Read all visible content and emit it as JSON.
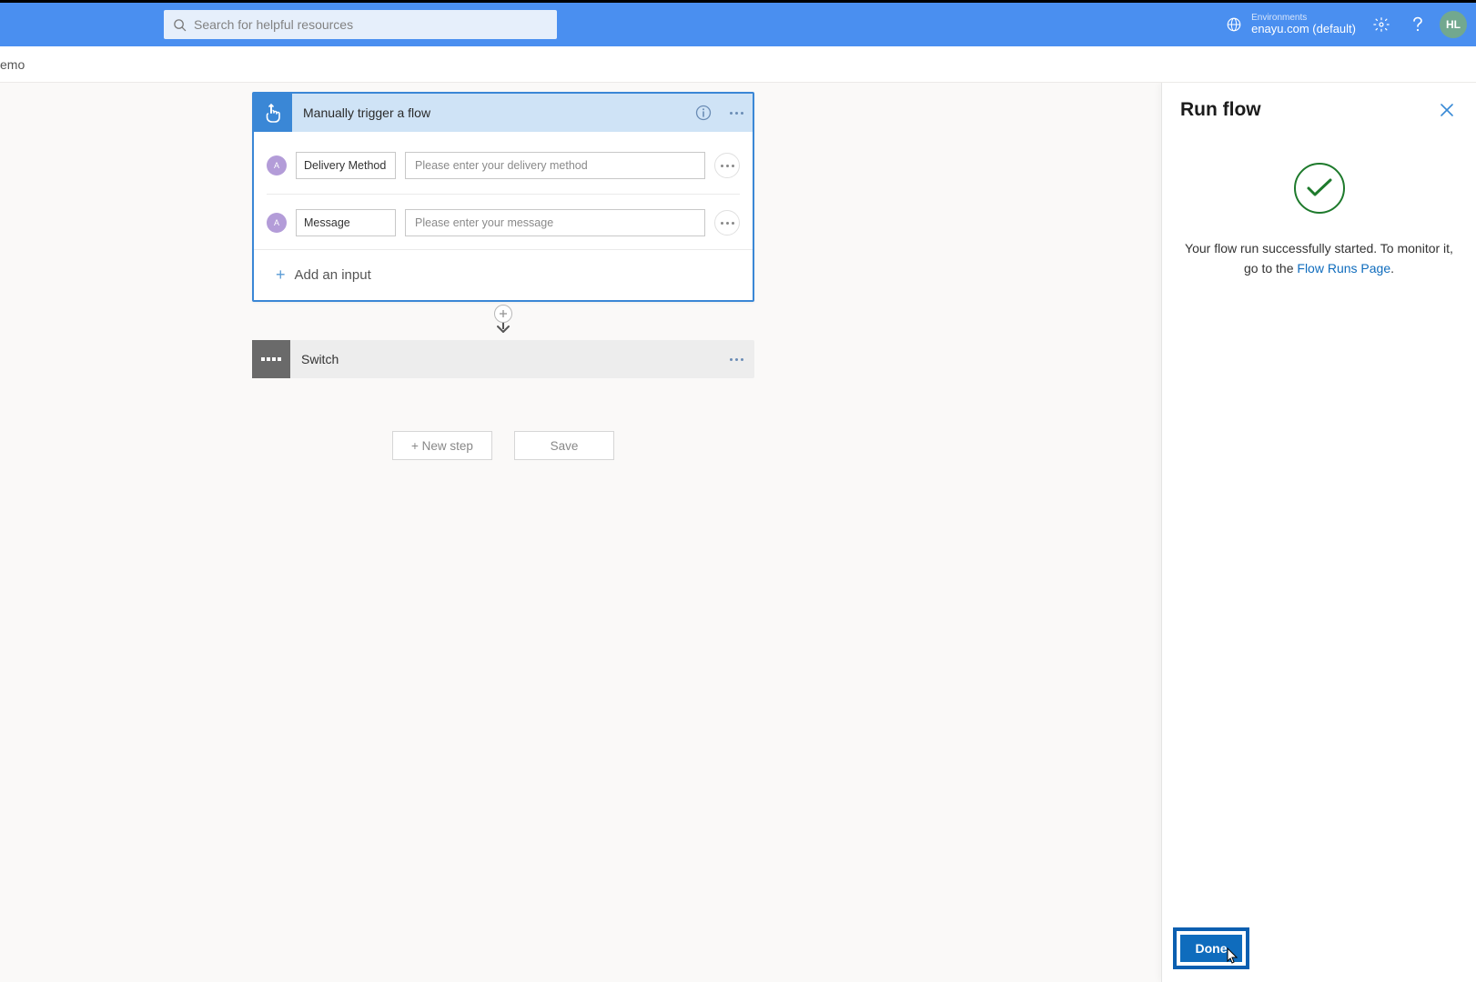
{
  "header": {
    "search_placeholder": "Search for helpful resources",
    "env_label": "Environments",
    "env_value": "enayu.com (default)",
    "avatar_initials": "HL"
  },
  "breadcrumb": {
    "text": "emo"
  },
  "trigger": {
    "title": "Manually trigger a flow",
    "inputs": [
      {
        "name": "Delivery Method",
        "placeholder": "Please enter your delivery method"
      },
      {
        "name": "Message",
        "placeholder": "Please enter your message"
      }
    ],
    "add_input_label": "Add an input"
  },
  "switch": {
    "title": "Switch"
  },
  "buttons": {
    "new_step": "+ New step",
    "save": "Save"
  },
  "panel": {
    "title": "Run flow",
    "message_before": "Your flow run successfully started. To monitor it, go to the ",
    "link_text": "Flow Runs Page",
    "message_after": ".",
    "done_label": "Done"
  }
}
